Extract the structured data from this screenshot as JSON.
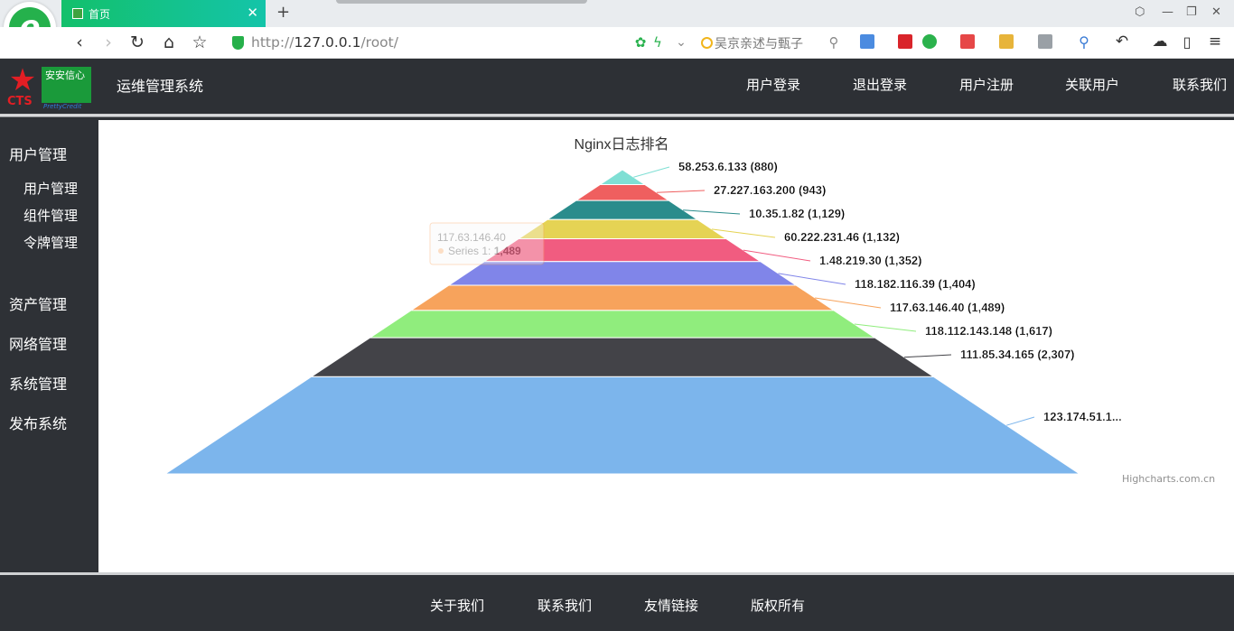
{
  "browser": {
    "tab_title": "首页",
    "url_prefix": "http://",
    "url_host": "127.0.0.1",
    "url_path": "/root/",
    "search_text": "吴京亲述与甄子"
  },
  "app": {
    "brand_logo_text": "安安信心",
    "brand_abbr": "CTS",
    "brand_sub": "PrettyCredit",
    "system_title": "运维管理系统",
    "nav": [
      "用户登录",
      "退出登录",
      "用户注册",
      "关联用户",
      "联系我们"
    ]
  },
  "sidebar": {
    "groups": [
      {
        "label": "用户管理",
        "items": [
          "用户管理",
          "组件管理",
          "令牌管理"
        ]
      },
      {
        "label": "资产管理",
        "items": []
      },
      {
        "label": "网络管理",
        "items": []
      },
      {
        "label": "系统管理",
        "items": []
      },
      {
        "label": "发布系统",
        "items": []
      }
    ]
  },
  "footer": {
    "links": [
      "关于我们",
      "联系我们",
      "友情链接",
      "版权所有"
    ]
  },
  "chart_data": {
    "type": "pyramid",
    "title": "Nginx日志排名",
    "credits": "Highcharts.com.cn",
    "series_name": "Series 1",
    "points": [
      {
        "name": "58.253.6.133",
        "value": 880,
        "label": "58.253.6.133 (880)",
        "color": "#7fdfd4"
      },
      {
        "name": "27.227.163.200",
        "value": 943,
        "label": "27.227.163.200 (943)",
        "color": "#ef5f5f"
      },
      {
        "name": "10.35.1.82",
        "value": 1129,
        "label": "10.35.1.82 (1,129)",
        "color": "#2a8c8c"
      },
      {
        "name": "60.222.231.46",
        "value": 1132,
        "label": "60.222.231.46 (1,132)",
        "color": "#e5d354"
      },
      {
        "name": "1.48.219.30",
        "value": 1352,
        "label": "1.48.219.30 (1,352)",
        "color": "#f15c80"
      },
      {
        "name": "118.182.116.39",
        "value": 1404,
        "label": "118.182.116.39 (1,404)",
        "color": "#8085e9"
      },
      {
        "name": "117.63.146.40",
        "value": 1489,
        "label": "117.63.146.40 (1,489)",
        "color": "#f7a35c"
      },
      {
        "name": "118.112.143.148",
        "value": 1617,
        "label": "118.112.143.148 (1,617)",
        "color": "#90ed7d"
      },
      {
        "name": "111.85.34.165",
        "value": 2307,
        "label": "111.85.34.165 (2,307)",
        "color": "#434348"
      },
      {
        "name": "123.174.51.1...",
        "value": null,
        "label": "123.174.51.1...",
        "color": "#7cb5ec"
      }
    ],
    "tooltip": {
      "title": "117.63.146.40",
      "series": "Series 1",
      "value": "1,489"
    }
  }
}
